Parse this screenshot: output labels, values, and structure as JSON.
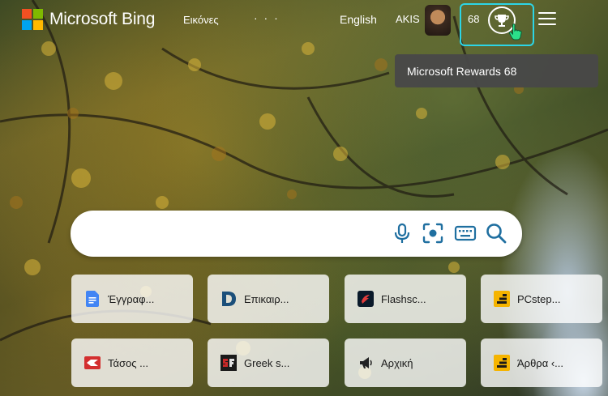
{
  "header": {
    "brand": "Microsoft Bing",
    "nav_images": "Εικόνες",
    "nav_more": "· · ·",
    "language": "English",
    "username": "AKIS",
    "rewards_count": "68"
  },
  "tooltip": {
    "text": "Microsoft Rewards 68"
  },
  "search": {
    "placeholder": "",
    "value": ""
  },
  "quick_links": [
    {
      "label": "Έγγραφ...",
      "icon": "google-docs-icon",
      "color": "#4285f4"
    },
    {
      "label": "Επικαιρ...",
      "icon": "d-logo-icon",
      "color": "#1b4f7a"
    },
    {
      "label": "Flashsc...",
      "icon": "flashscore-icon",
      "color": "#e03c3c"
    },
    {
      "label": "PCstep...",
      "icon": "pcsteps-icon",
      "color": "#f5b400"
    },
    {
      "label": "Τάσος ...",
      "icon": "tasos-icon",
      "color": "#d32f2f"
    },
    {
      "label": "Greek s...",
      "icon": "greek-sf-icon",
      "color": "#c62828"
    },
    {
      "label": "Αρχική",
      "icon": "megaphone-icon",
      "color": "#222222"
    },
    {
      "label": "Άρθρα ‹...",
      "icon": "pcsteps-icon",
      "color": "#f5b400"
    }
  ],
  "colors": {
    "accent": "#2cd5e6",
    "search_icons": "#1f6fa0"
  }
}
